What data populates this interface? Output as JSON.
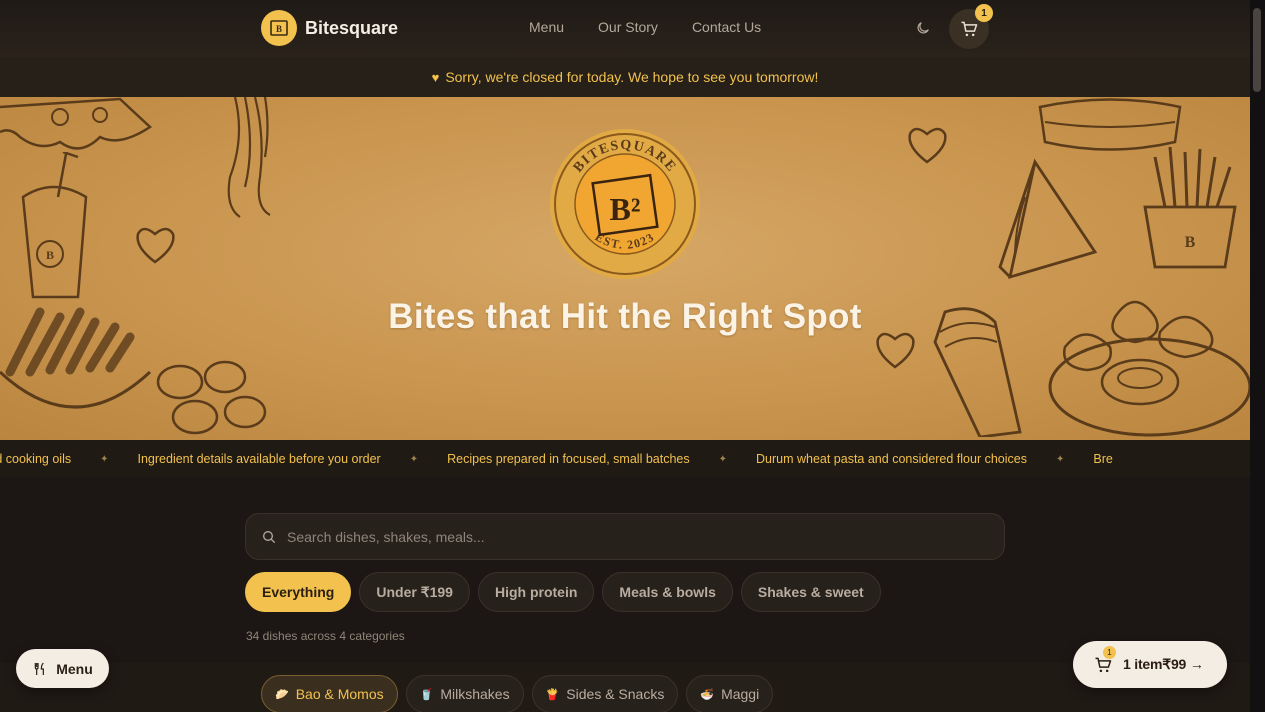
{
  "nav": {
    "brand_name": "Bitesquare",
    "links": [
      "Menu",
      "Our Story",
      "Contact Us"
    ],
    "cart_count": "1",
    "theme_icon": "moon-icon",
    "cart_icon": "cart-icon"
  },
  "banner": {
    "text": "Sorry, we're closed for today. We hope to see you tomorrow!",
    "icon": "heart-icon"
  },
  "hero": {
    "title": "Bites that Hit the Right Spot",
    "seal_top_text": "BITESQUARE",
    "seal_bottom_text": "EST. 2023",
    "seal_mark": "B²"
  },
  "ticker": {
    "items": [
      "elected cooking oils",
      "Ingredient details available before you order",
      "Recipes prepared in focused, small batches",
      "Durum wheat pasta and considered flour choices",
      "Bre"
    ]
  },
  "search": {
    "placeholder": "Search dishes, shakes, meals..."
  },
  "filters": {
    "items": [
      "Everything",
      "Under ₹199",
      "High protein",
      "Meals & bowls",
      "Shakes & sweet"
    ],
    "active": "Everything"
  },
  "count_text": "34 dishes across 4 categories",
  "categories": {
    "items": [
      {
        "label": "Bao & Momos",
        "icon": "bao-icon"
      },
      {
        "label": "Milkshakes",
        "icon": "milkshake-icon"
      },
      {
        "label": "Sides & Snacks",
        "icon": "fries-icon"
      },
      {
        "label": "Maggi",
        "icon": "noodle-bowl-icon"
      }
    ],
    "active": "Bao & Momos"
  },
  "floating": {
    "menu_label": "Menu",
    "cart_badge": "1",
    "cart_summary": "1 item₹99 →"
  },
  "colors": {
    "accent": "#f2c14e",
    "background": "#1c1714",
    "hero": "#c9954f"
  }
}
